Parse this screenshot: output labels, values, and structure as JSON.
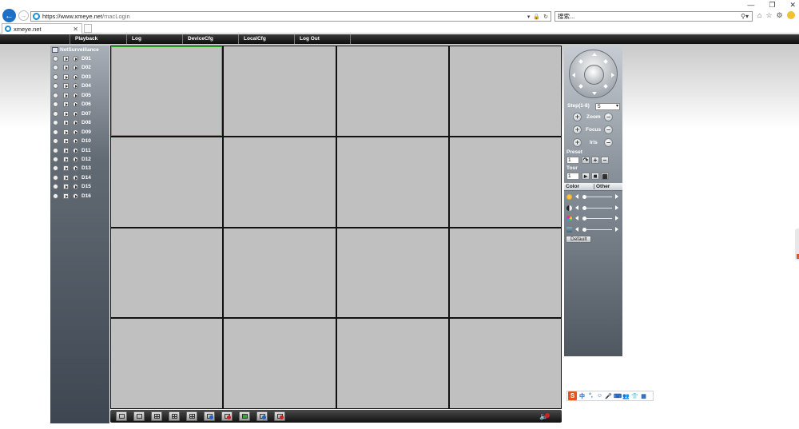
{
  "browser": {
    "url_prefix": "https://www.xmeye.net",
    "url_path": "/macLogin",
    "search_placeholder": "搜索...",
    "tab_title": "xmeye.net",
    "search_icon": "search-icon",
    "window_controls": [
      "—",
      "❐",
      "✕"
    ]
  },
  "menu": {
    "items": [
      "Playback",
      "Log",
      "DeviceCfg",
      "LocalCfg",
      "Log Out"
    ]
  },
  "devices": {
    "root_label": "NetSurveillance",
    "channels": [
      "D01",
      "D02",
      "D03",
      "D04",
      "D05",
      "D06",
      "D07",
      "D08",
      "D09",
      "D10",
      "D11",
      "D12",
      "D13",
      "D14",
      "D15",
      "D16"
    ]
  },
  "grid": {
    "rows": 4,
    "cols": 4,
    "selected_index": 0
  },
  "ptz": {
    "step_label": "Step(1-8)",
    "step_value": "5",
    "zoom_label": "Zoom",
    "focus_label": "Focus",
    "iris_label": "Iris",
    "preset_label": "Preset",
    "preset_value": "1",
    "tour_label": "Tour",
    "tour_value": "1",
    "color_tab": "Color",
    "other_tab": "Other",
    "default_button": "Default",
    "slider_levels": [
      0.05,
      0.05,
      0.05,
      0.05
    ]
  },
  "ime": {
    "items": [
      "中",
      "°,",
      "☺",
      "🎤",
      "⌨",
      "👥",
      "👕",
      "▦"
    ]
  },
  "colors": {
    "selected_cell_border": "#41c041",
    "cell_bg": "#c0c0c0",
    "brand_blue": "#1f6fc5"
  }
}
